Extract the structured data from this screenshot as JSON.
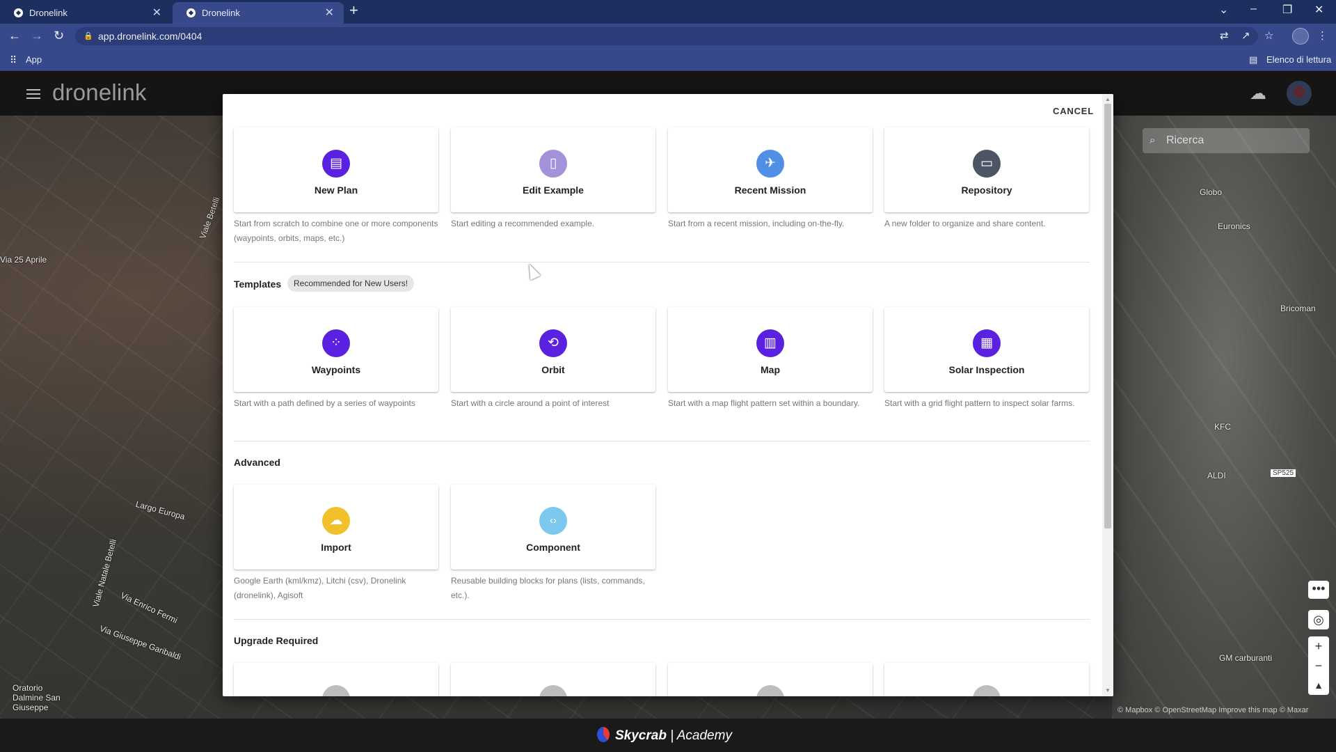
{
  "browser": {
    "tabs": [
      {
        "title": "Dronelink"
      },
      {
        "title": "Dronelink"
      }
    ],
    "url": "app.dronelink.com/0404",
    "bookmarks": {
      "apps": "App",
      "reading_list": "Elenco di lettura"
    }
  },
  "app": {
    "brand": "dronelink",
    "search_placeholder": "Ricerca"
  },
  "modal": {
    "cancel_label": "CANCEL",
    "top_cards": [
      {
        "title": "New Plan",
        "icon": "clipboard-icon",
        "color": "#5b21e0",
        "desc": "Start from scratch to combine one or more components (waypoints, orbits, maps, etc.)"
      },
      {
        "title": "Edit Example",
        "icon": "document-icon",
        "color": "#a391d9",
        "desc": "Start editing a recommended example."
      },
      {
        "title": "Recent Mission",
        "icon": "airplane-icon",
        "color": "#4f8fe6",
        "desc": "Start from a recent mission, including on-the-fly."
      },
      {
        "title": "Repository",
        "icon": "folder-open-icon",
        "color": "#4b5563",
        "desc": "A new folder to organize and share content."
      }
    ],
    "templates_label": "Templates",
    "templates_chip": "Recommended for New Users!",
    "template_cards": [
      {
        "title": "Waypoints",
        "icon": "waypoints-icon",
        "color": "#5b21e0",
        "desc": "Start with a path defined by a series of waypoints"
      },
      {
        "title": "Orbit",
        "icon": "orbit-icon",
        "color": "#5b21e0",
        "desc": "Start with a circle around a point of interest"
      },
      {
        "title": "Map",
        "icon": "map-icon",
        "color": "#5b21e0",
        "desc": "Start with a map flight pattern set within a boundary."
      },
      {
        "title": "Solar Inspection",
        "icon": "grid-icon",
        "color": "#5b21e0",
        "desc": "Start with a grid flight pattern to inspect solar farms."
      }
    ],
    "advanced_label": "Advanced",
    "advanced_cards": [
      {
        "title": "Import",
        "icon": "cloud-upload-icon",
        "color": "#f2c02a",
        "desc": "Google Earth (kml/kmz), Litchi (csv), Dronelink (dronelink), Agisoft"
      },
      {
        "title": "Component",
        "icon": "code-icon",
        "color": "#7cc8ef",
        "desc": "Reusable building blocks for plans (lists, commands, etc.)."
      }
    ],
    "upgrade_label": "Upgrade Required"
  },
  "map": {
    "labels": [
      {
        "text": "Via 25 Aprile",
        "name": "map-label-via-25-aprile"
      },
      {
        "text": "Viale Betelli",
        "name": "map-label-viale-betelli"
      },
      {
        "text": "Largo Europa",
        "name": "map-label-largo-europa"
      },
      {
        "text": "Viale Natale Betelli",
        "name": "map-label-viale-natale-betelli"
      },
      {
        "text": "Via Enrico Fermi",
        "name": "map-label-via-enrico-fermi"
      },
      {
        "text": "Via Giuseppe Garibaldi",
        "name": "map-label-via-garibaldi"
      },
      {
        "text": "Oratorio Dalmine San Giuseppe",
        "name": "map-label-oratorio"
      },
      {
        "text": "Globo",
        "name": "map-label-globo"
      },
      {
        "text": "Euronics",
        "name": "map-label-euronics"
      },
      {
        "text": "Bricoman",
        "name": "map-label-bricoman"
      },
      {
        "text": "KFC",
        "name": "map-label-kfc"
      },
      {
        "text": "ALDI",
        "name": "map-label-aldi"
      },
      {
        "text": "GM carburanti",
        "name": "map-label-gm-carburanti"
      },
      {
        "text": "SP525",
        "name": "map-label-sp525"
      }
    ],
    "attribution": "© Mapbox © OpenStreetMap Improve this map © Maxar"
  },
  "footer": {
    "brand": "Skycrab",
    "suffix": "| Academy"
  }
}
